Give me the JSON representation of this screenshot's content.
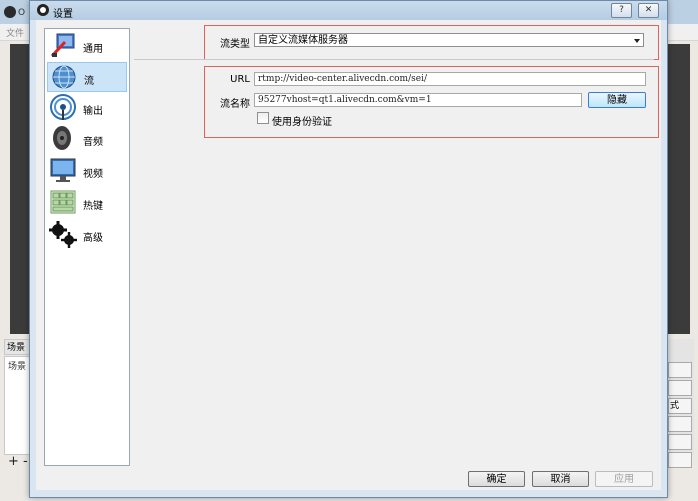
{
  "background_window": {
    "title": "O",
    "menu_first": "文件",
    "scenes_header": "场景",
    "scenes_item": "场景",
    "add_glyph": "+ -",
    "side_glyph": "式"
  },
  "dialog": {
    "title": "设置",
    "help_label": "?",
    "close_label": "✕"
  },
  "sidebar": {
    "items": [
      {
        "label": "通用",
        "icon": "general-icon"
      },
      {
        "label": "流",
        "icon": "stream-globe-icon",
        "selected": true
      },
      {
        "label": "输出",
        "icon": "output-signal-icon"
      },
      {
        "label": "音频",
        "icon": "speaker-icon"
      },
      {
        "label": "视频",
        "icon": "monitor-icon"
      },
      {
        "label": "热键",
        "icon": "keyboard-icon"
      },
      {
        "label": "高级",
        "icon": "gears-icon"
      }
    ]
  },
  "stream": {
    "type_label": "流类型",
    "type_value": "自定义流媒体服务器",
    "url_label": "URL",
    "url_value": "rtmp://video-center.alivecdn.com/sei/",
    "key_label": "流名称",
    "key_value": "95277vhost=qt1.alivecdn.com&vm=1",
    "hide_button": "隐藏",
    "auth_checkbox_label": "使用身份验证",
    "auth_checked": false
  },
  "footer": {
    "ok": "确定",
    "cancel": "取消",
    "apply": "应用"
  },
  "colors": {
    "highlight_border": "#e0625a",
    "selected_bg": "#cce4f7"
  }
}
